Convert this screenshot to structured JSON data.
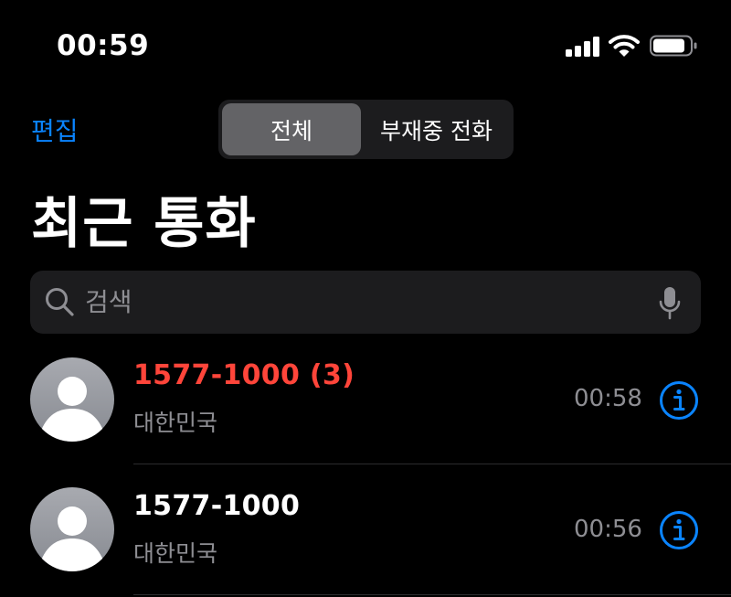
{
  "status_bar": {
    "time": "00:59",
    "icons": [
      "cellular-signal-icon",
      "wifi-icon",
      "battery-icon"
    ]
  },
  "nav": {
    "edit_label": "편집",
    "segments": [
      {
        "label": "전체",
        "selected": true
      },
      {
        "label": "부재중 전화",
        "selected": false
      }
    ]
  },
  "title": "최근 통화",
  "search": {
    "placeholder": "검색",
    "value": ""
  },
  "calls": [
    {
      "caller": "1577-1000 (3)",
      "location": "대한민국",
      "time": "00:58",
      "missed": true
    },
    {
      "caller": "1577-1000",
      "location": "대한민국",
      "time": "00:56",
      "missed": false
    }
  ],
  "colors": {
    "accent": "#0a84ff",
    "missed": "#ff453a",
    "secondary_text": "#8e8e93",
    "background": "#000000",
    "field_background": "#1c1c1e",
    "selected_segment": "#636366"
  }
}
